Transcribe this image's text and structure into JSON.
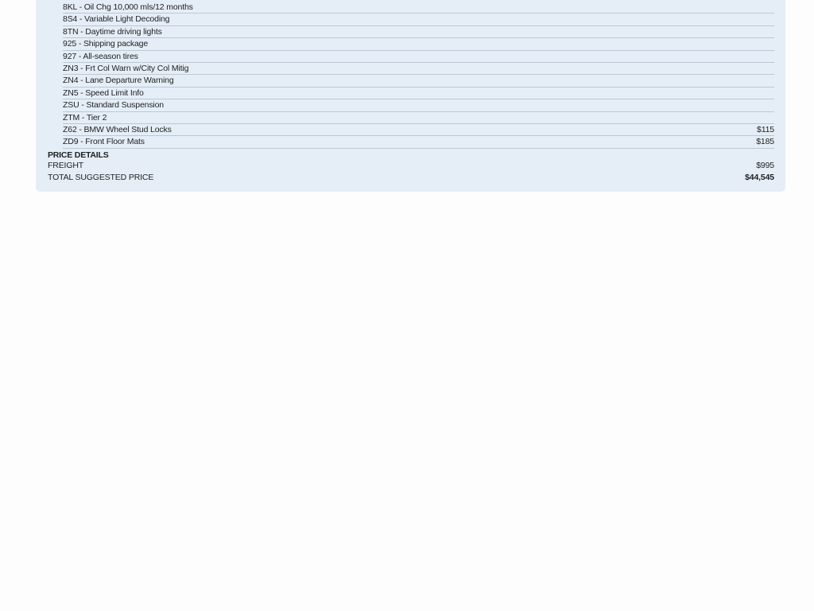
{
  "options": [
    {
      "label": "8KL - Oil Chg 10,000 mls/12 months",
      "price": ""
    },
    {
      "label": "8S4 - Variable Light Decoding",
      "price": ""
    },
    {
      "label": "8TN - Daytime driving lights",
      "price": ""
    },
    {
      "label": "925 - Shipping package",
      "price": ""
    },
    {
      "label": "927 - All-season tires",
      "price": ""
    },
    {
      "label": "ZN3 - Frt Col Warn w/City Col Mitig",
      "price": ""
    },
    {
      "label": "ZN4 - Lane Departure Warning",
      "price": ""
    },
    {
      "label": "ZN5 - Speed Limit Info",
      "price": ""
    },
    {
      "label": "ZSU - Standard Suspension",
      "price": ""
    },
    {
      "label": "ZTM - Tier 2",
      "price": ""
    },
    {
      "label": "Z62 - BMW Wheel Stud Locks",
      "price": "$115"
    },
    {
      "label": "ZD9 - Front Floor Mats",
      "price": "$185"
    }
  ],
  "price_details": {
    "heading": "PRICE DETAILS",
    "freight_label": "FREIGHT",
    "freight_value": "$995",
    "total_label": "TOTAL SUGGESTED PRICE",
    "total_value": "$44,545"
  }
}
